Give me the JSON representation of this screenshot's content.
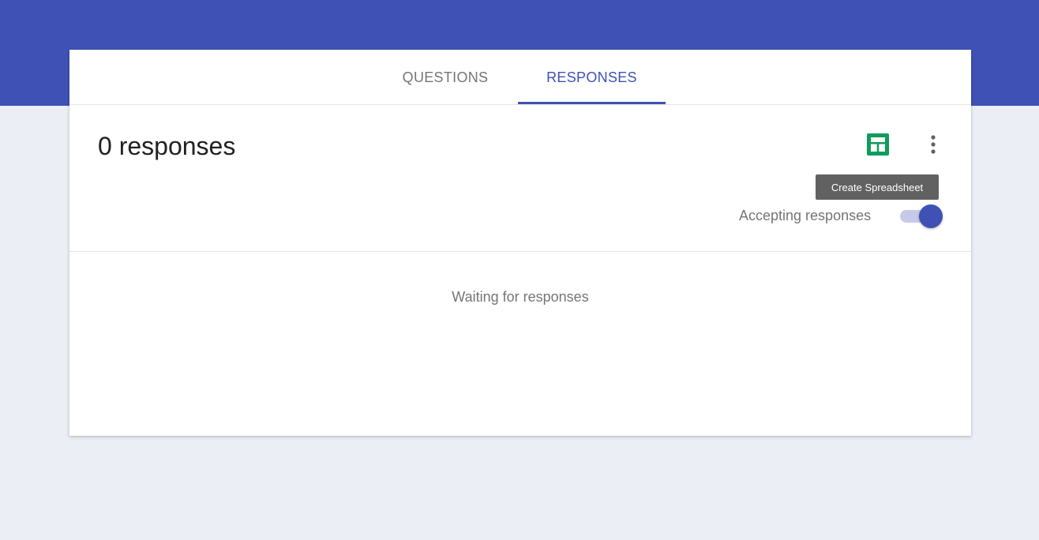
{
  "tabs": {
    "questions": "QUESTIONS",
    "responses": "RESPONSES",
    "active": "responses"
  },
  "summary": {
    "count_label": "0 responses"
  },
  "toolbar": {
    "spreadsheet_icon": "sheets-icon",
    "more_icon": "more-vert-icon",
    "tooltip": "Create Spreadsheet"
  },
  "accepting": {
    "label": "Accepting responses",
    "enabled": true
  },
  "empty_state": {
    "message": "Waiting for responses"
  },
  "colors": {
    "primary": "#3f51b5",
    "background": "#eceef6",
    "sheets_green": "#0f9d58",
    "toggle_track": "#c5cae9",
    "tooltip_bg": "#616161"
  }
}
